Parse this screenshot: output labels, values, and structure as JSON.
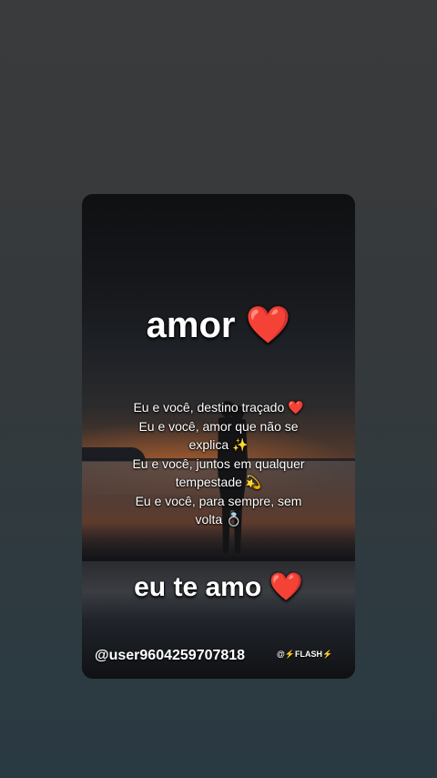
{
  "post": {
    "title": "amor",
    "title_emoji": "❤️",
    "verses": [
      "Eu e você, destino traçado ❤️",
      "Eu e você, amor que não se",
      "explica ✨",
      "Eu e você, juntos em qualquer",
      "tempestade 💫",
      "Eu e você, para sempre, sem",
      "volta 💍"
    ],
    "closing": "eu te amo",
    "closing_emoji": "❤️",
    "username": "@user9604259707818",
    "watermark": "@⚡FLASH⚡"
  },
  "colors": {
    "page_background": "#36393b",
    "text": "#ffffff",
    "heart": "#e3121b"
  }
}
